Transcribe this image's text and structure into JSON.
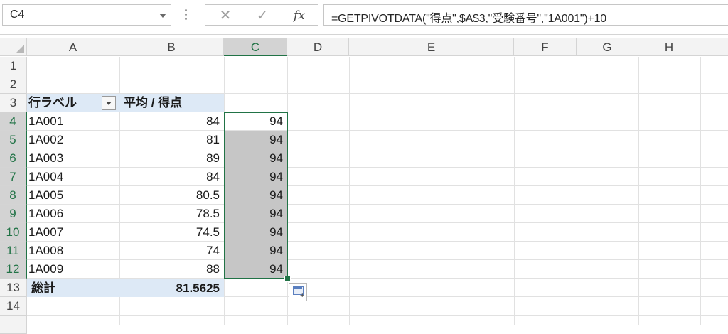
{
  "formula_bar": {
    "name_box": "C4",
    "cancel": "✕",
    "enter": "✓",
    "fx": "fx",
    "formula": "=GETPIVOTDATA(\"得点\",$A$3,\"受験番号\",\"1A001\")+10"
  },
  "columns": [
    "A",
    "B",
    "C",
    "D",
    "E",
    "F",
    "G",
    "H"
  ],
  "rows": [
    "1",
    "2",
    "3",
    "4",
    "5",
    "6",
    "7",
    "8",
    "9",
    "10",
    "11",
    "12",
    "13",
    "14"
  ],
  "pivot": {
    "row_label_header": "行ラベル",
    "value_header": "平均 / 得点",
    "items": [
      {
        "label": "1A001",
        "value": "84"
      },
      {
        "label": "1A002",
        "value": "81"
      },
      {
        "label": "1A003",
        "value": "89"
      },
      {
        "label": "1A004",
        "value": "84"
      },
      {
        "label": "1A005",
        "value": "80.5"
      },
      {
        "label": "1A006",
        "value": "78.5"
      },
      {
        "label": "1A007",
        "value": "74.5"
      },
      {
        "label": "1A008",
        "value": "74"
      },
      {
        "label": "1A009",
        "value": "88"
      }
    ],
    "total_label": "総計",
    "total_value": "81.5625"
  },
  "column_c": [
    "94",
    "94",
    "94",
    "94",
    "94",
    "94",
    "94",
    "94",
    "94"
  ],
  "colors": {
    "selection": "#217346",
    "pivot_band": "#dde9f6",
    "selected_fill": "#c6c6c6"
  }
}
